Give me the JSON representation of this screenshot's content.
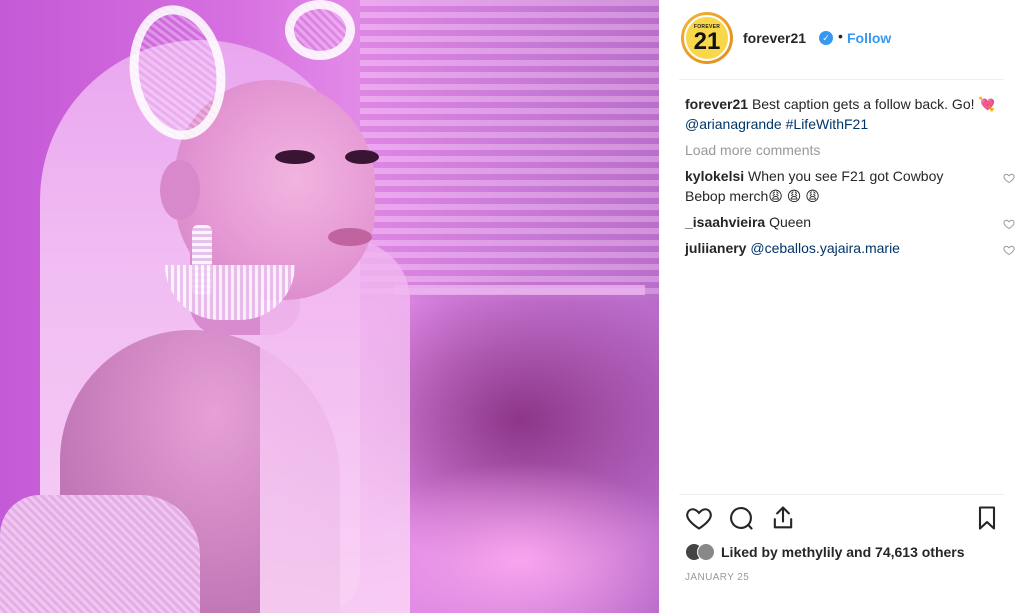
{
  "post": {
    "account": {
      "username": "forever21",
      "verified": true,
      "avatar_text_small": "FOREVER",
      "avatar_text_big": "21",
      "follow_label": "Follow",
      "separator": "•"
    },
    "caption": {
      "username": "forever21",
      "text": "Best caption gets a follow back. Go! 💘",
      "mention": "@arianagrande",
      "hashtag": "#LifeWithF21"
    },
    "load_more_label": "Load more comments",
    "comments": [
      {
        "username": "kylokelsi",
        "text": "When you see F21 got Cowboy Bebop merch😩 😩 😩"
      },
      {
        "username": "_isaahvieira",
        "text": "Queen"
      },
      {
        "username": "juliianery",
        "text": "",
        "mention": "@ceballos.yajaira.marie"
      }
    ],
    "likes_text": "Liked by methylily and 74,613 others",
    "date": "JANUARY 25"
  },
  "icons": {
    "like": "heart-icon",
    "comment": "comment-icon",
    "share": "share-icon",
    "save": "bookmark-icon",
    "comment_like": "heart-icon"
  },
  "colors": {
    "link": "#3897f0",
    "mention": "#003569",
    "muted": "#999999",
    "text": "#262626"
  }
}
